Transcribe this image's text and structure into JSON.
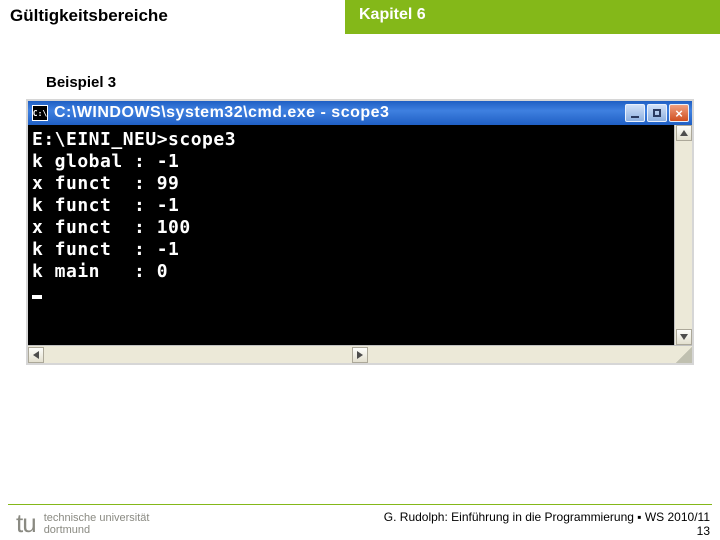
{
  "header": {
    "title": "Gültigkeitsbereiche",
    "chapter": "Kapitel 6"
  },
  "subtitle": "Beispiel 3",
  "console": {
    "window_title": "C:\\WINDOWS\\system32\\cmd.exe - scope3",
    "icon_label": "C:\\",
    "output": "E:\\EINI_NEU>scope3\nk global : -1\nx funct  : 99\nk funct  : -1\nx funct  : 100\nk funct  : -1\nk main   : 0"
  },
  "footer": {
    "uni_line1": "technische universität",
    "uni_line2": "dortmund",
    "attribution": "G. Rudolph: Einführung in die Programmierung ▪ WS 2010/11",
    "page": "13"
  }
}
